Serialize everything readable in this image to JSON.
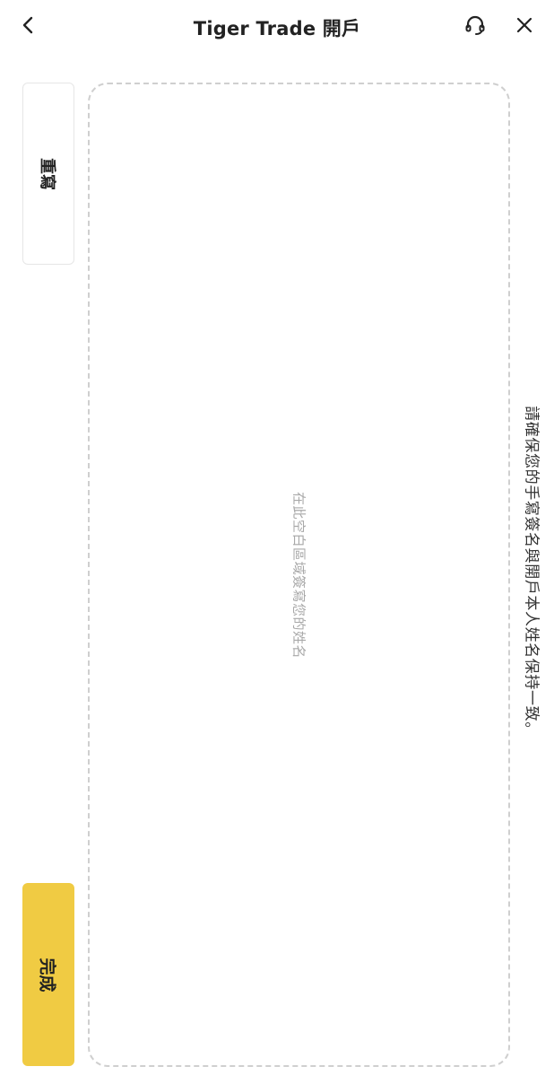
{
  "header": {
    "title": "Tiger Trade 開戶",
    "back_icon": "chevron-left-icon",
    "support_icon": "headset-icon",
    "close_icon": "close-icon"
  },
  "actions": {
    "rewrite_label": "重寫",
    "done_label": "完成",
    "done_color": "#f0cb43"
  },
  "signature": {
    "placeholder": "在此空白區域簽寫您的姓名"
  },
  "notice": {
    "text": "請確保您的手寫簽名與開戶本人姓名保持一致。"
  }
}
